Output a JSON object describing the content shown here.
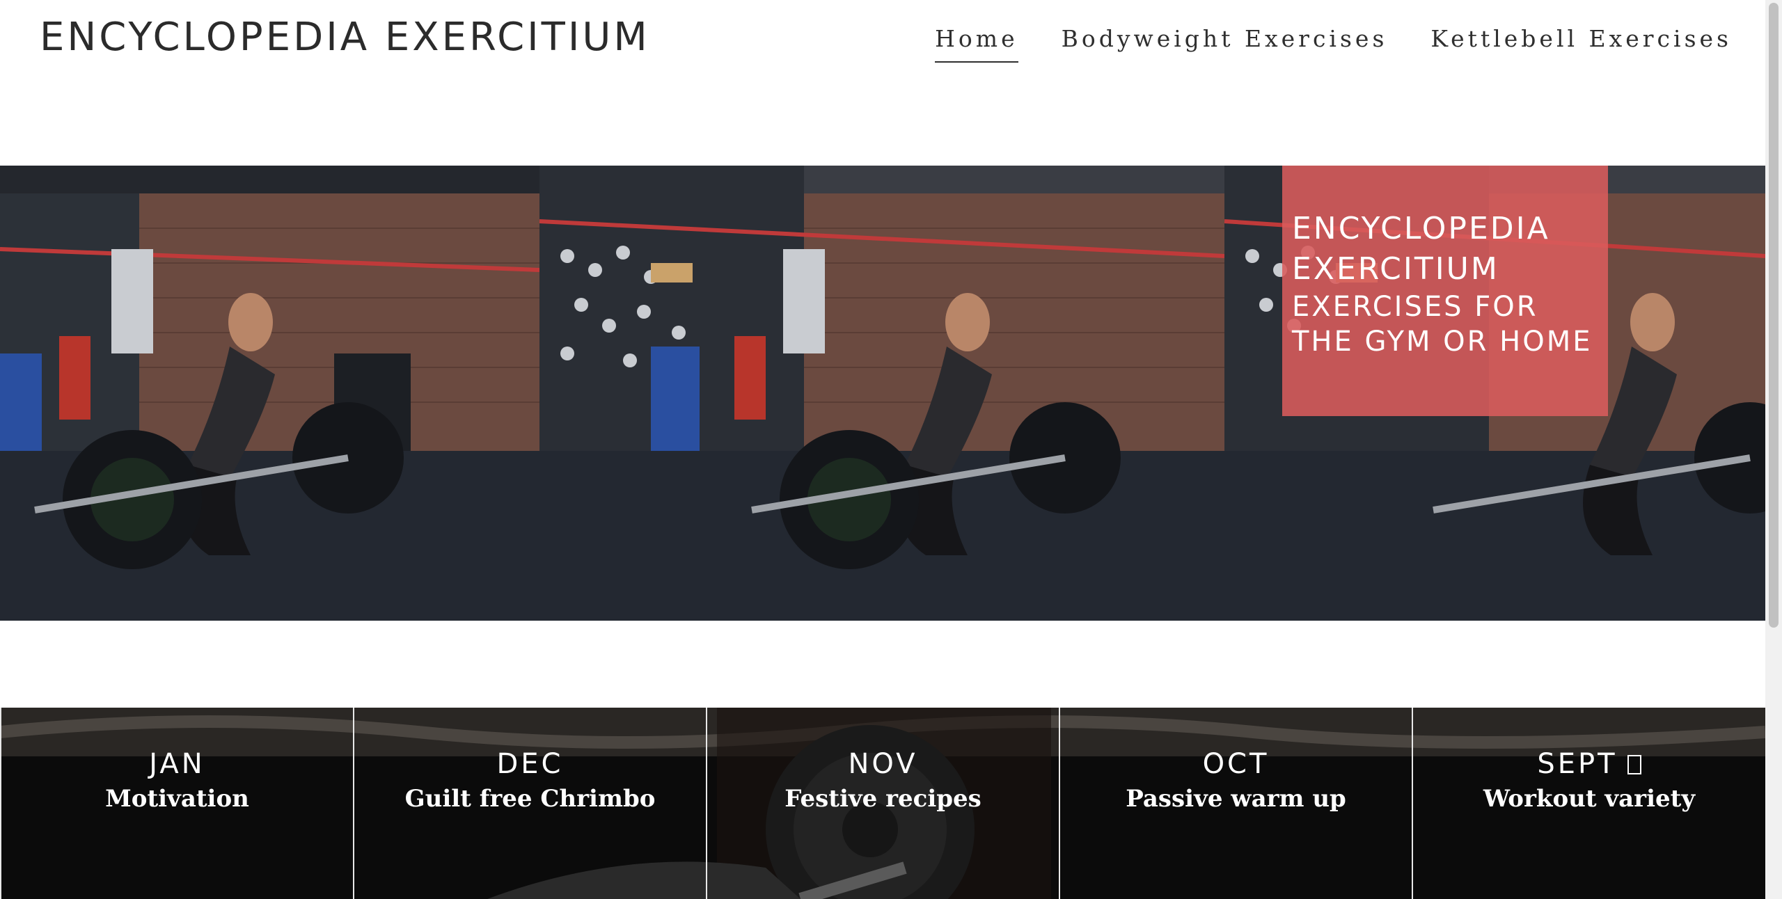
{
  "header": {
    "site_title": "ENCYCLOPEDIA EXERCITIUM",
    "nav": [
      {
        "label": "Home",
        "active": true
      },
      {
        "label": "Bodyweight Exercises",
        "active": false
      },
      {
        "label": "Kettlebell Exercises",
        "active": false
      }
    ]
  },
  "hero": {
    "image": "woman-barbell-deadlift-gym-photo",
    "panel_count": 3,
    "overlay_title": "ENCYCLOPEDIA EXERCITIUM",
    "overlay_subtitle": "EXERCISES FOR THE GYM OR HOME",
    "overlay_color": "#da5c5c"
  },
  "tiles": {
    "background_image": "barbell-plate-dark-photo",
    "items": [
      {
        "month": "JAN",
        "topic": "Motivation"
      },
      {
        "month": "DEC",
        "topic": "Guilt free Chrimbo"
      },
      {
        "month": "NOV",
        "topic": "Festive recipes"
      },
      {
        "month": "OCT",
        "topic": "Passive warm up"
      },
      {
        "month": "SEPT",
        "topic": "Workout variety",
        "icon": "missing-glyph-icon"
      }
    ]
  },
  "colors": {
    "accent": "#da5c5c",
    "text": "#2b2b2b",
    "tile_background": "#080808"
  }
}
